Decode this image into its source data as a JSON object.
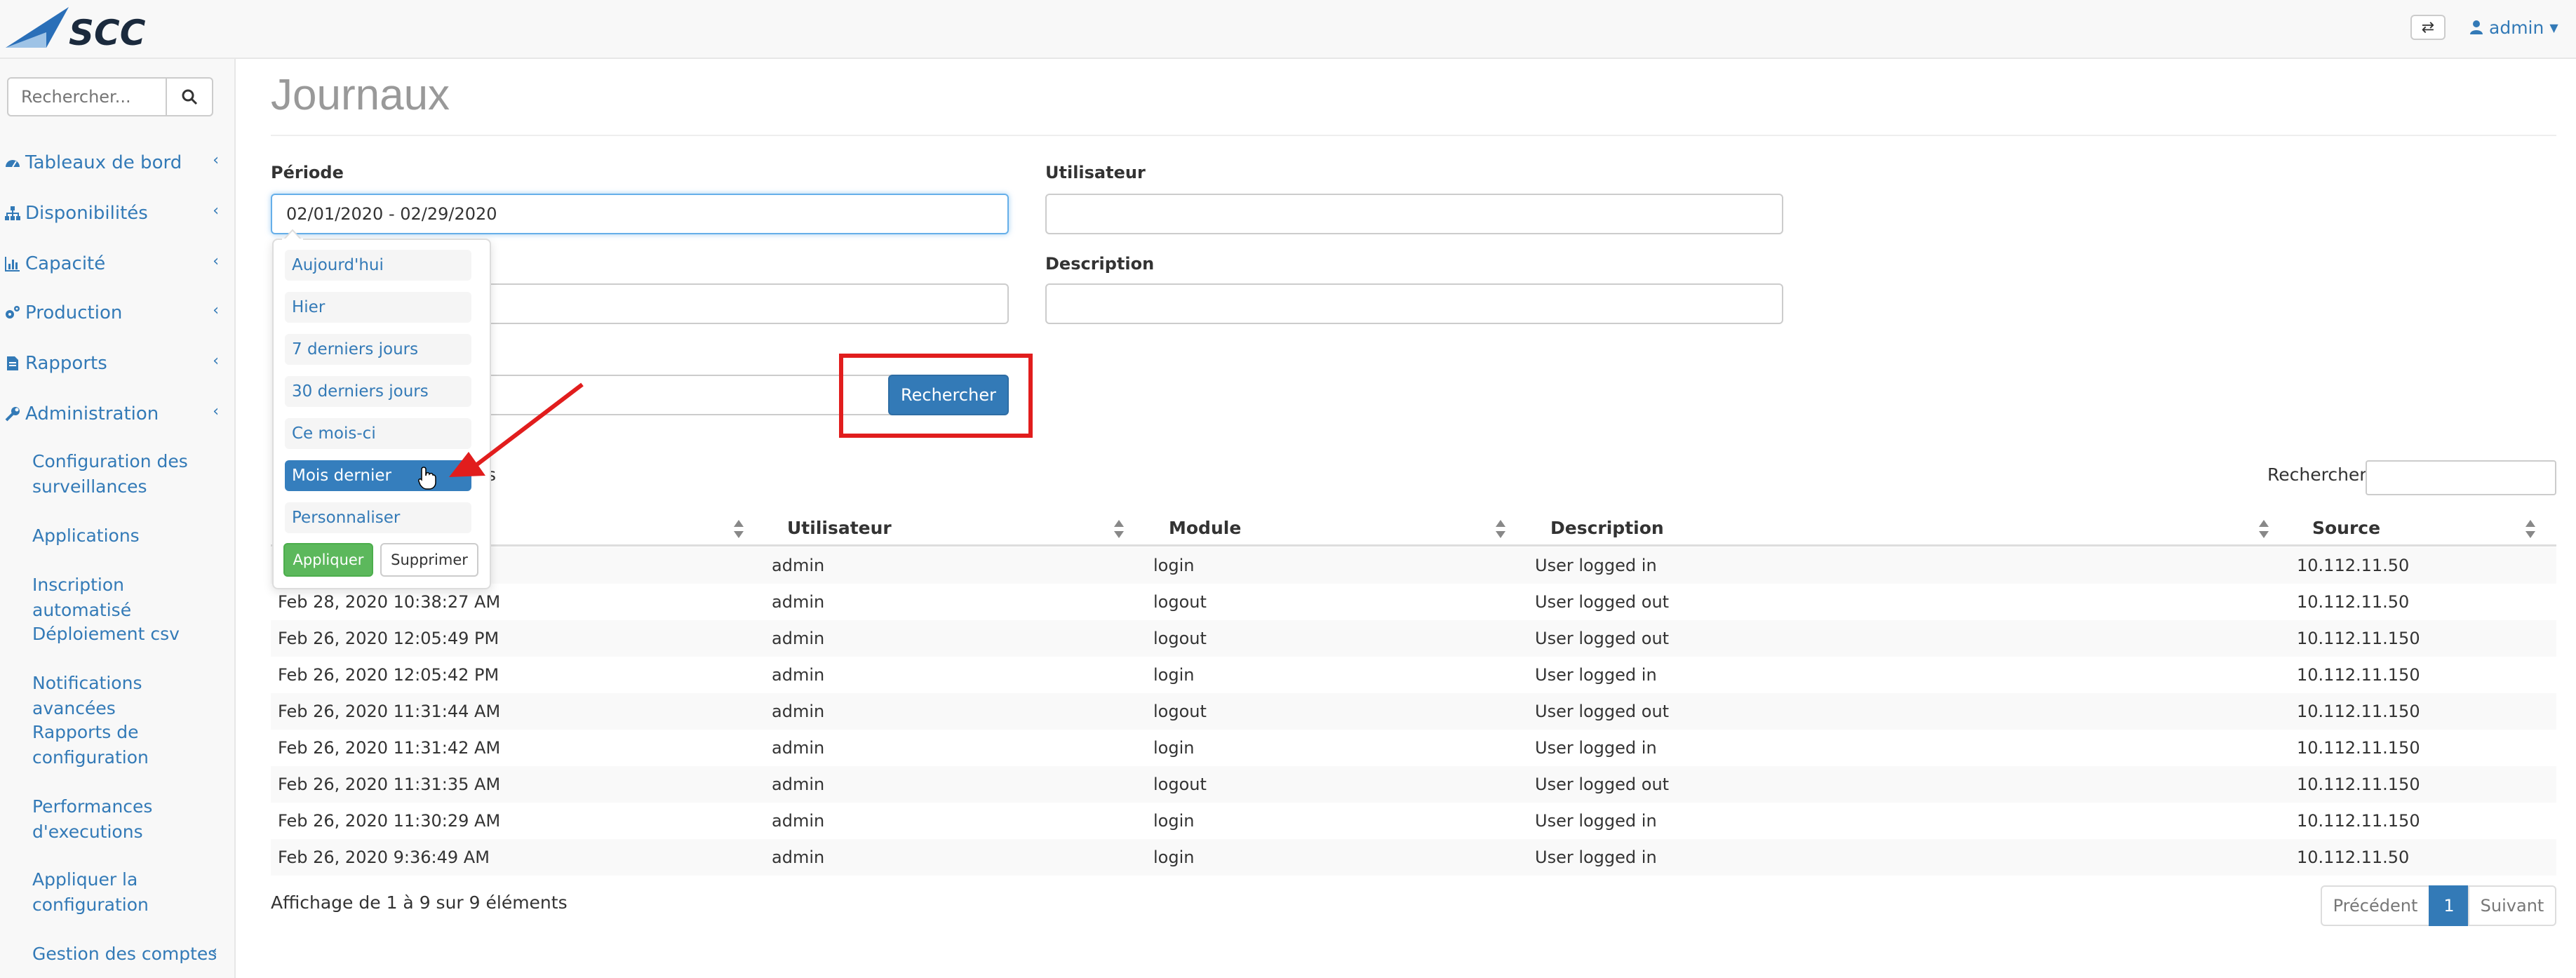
{
  "app": {
    "logo_text": "SCC",
    "brand_color": "#337ab7"
  },
  "header": {
    "switch_icon": "exchange-icon",
    "user_icon": "user-icon",
    "user_label": "admin",
    "caret_icon": "caret-down-icon"
  },
  "sidebar": {
    "search_placeholder": "Rechercher...",
    "items": [
      {
        "label": "Tableaux de bord",
        "icon": "dashboard-icon"
      },
      {
        "label": "Disponibilités",
        "icon": "sitemap-icon"
      },
      {
        "label": "Capacité",
        "icon": "bar-chart-icon"
      },
      {
        "label": "Production",
        "icon": "cogs-icon"
      },
      {
        "label": "Rapports",
        "icon": "file-icon"
      },
      {
        "label": "Administration",
        "icon": "wrench-icon"
      }
    ],
    "sub_items": [
      "Configuration des surveillances",
      "Applications",
      "Inscription automatisé",
      "Déploiement csv",
      "Notifications avancées",
      "Rapports de configuration",
      "Performances d'executions",
      "Appliquer la configuration",
      "Gestion des comptes"
    ]
  },
  "page": {
    "title": "Journaux"
  },
  "form": {
    "periode_label": "Période",
    "periode_value": "02/01/2020 - 02/29/2020",
    "utilisateur_label": "Utilisateur",
    "description_label": "Description",
    "search_button": "Rechercher"
  },
  "date_picker": {
    "ranges": [
      "Aujourd'hui",
      "Hier",
      "7 derniers jours",
      "30 derniers jours",
      "Ce mois-ci",
      "Mois dernier",
      "Personnaliser"
    ],
    "active_range": "Mois dernier",
    "apply_label": "Appliquer",
    "cancel_label": "Supprimer"
  },
  "table": {
    "length_text_suffix": "s",
    "search_label": "Rechercher:",
    "columns": [
      "Utilisateur",
      "Module",
      "Description",
      "Source"
    ],
    "rows": [
      {
        "date": "",
        "user": "admin",
        "module": "login",
        "description": "User logged in",
        "source": "10.112.11.50"
      },
      {
        "date": "Feb 28, 2020 10:38:27 AM",
        "user": "admin",
        "module": "logout",
        "description": "User logged out",
        "source": "10.112.11.50"
      },
      {
        "date": "Feb 26, 2020 12:05:49 PM",
        "user": "admin",
        "module": "logout",
        "description": "User logged out",
        "source": "10.112.11.150"
      },
      {
        "date": "Feb 26, 2020 12:05:42 PM",
        "user": "admin",
        "module": "login",
        "description": "User logged in",
        "source": "10.112.11.150"
      },
      {
        "date": "Feb 26, 2020 11:31:44 AM",
        "user": "admin",
        "module": "logout",
        "description": "User logged out",
        "source": "10.112.11.150"
      },
      {
        "date": "Feb 26, 2020 11:31:42 AM",
        "user": "admin",
        "module": "login",
        "description": "User logged in",
        "source": "10.112.11.150"
      },
      {
        "date": "Feb 26, 2020 11:31:35 AM",
        "user": "admin",
        "module": "logout",
        "description": "User logged out",
        "source": "10.112.11.150"
      },
      {
        "date": "Feb 26, 2020 11:30:29 AM",
        "user": "admin",
        "module": "login",
        "description": "User logged in",
        "source": "10.112.11.150"
      },
      {
        "date": "Feb 26, 2020 9:36:49 AM",
        "user": "admin",
        "module": "login",
        "description": "User logged in",
        "source": "10.112.11.50"
      }
    ],
    "info": "Affichage de 1 à 9 sur 9 éléments",
    "pagination": {
      "prev": "Précédent",
      "page": "1",
      "next": "Suivant"
    }
  },
  "annotations": {
    "highlight_color": "#e11d1d"
  }
}
